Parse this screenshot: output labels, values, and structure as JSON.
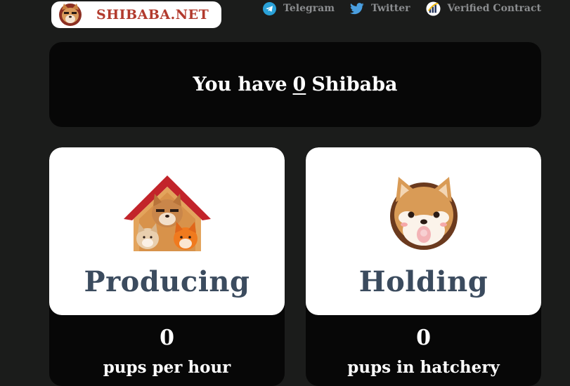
{
  "header": {
    "logo_text": "SHIBABA.NET",
    "links": [
      {
        "label": "Telegram",
        "icon": "telegram-icon"
      },
      {
        "label": "Twitter",
        "icon": "twitter-icon"
      },
      {
        "label": "Verified Contract",
        "icon": "chart-icon"
      }
    ]
  },
  "balance": {
    "prefix": "You have",
    "amount": "0",
    "suffix": "Shibaba"
  },
  "cards": [
    {
      "title": "Producing",
      "value": "0",
      "label": "pups per hour",
      "icon": "doghouse-icon"
    },
    {
      "title": "Holding",
      "value": "0",
      "label": "pups in hatchery",
      "icon": "shiba-face-icon"
    }
  ],
  "colors": {
    "background": "#1b1c1b",
    "card_dark": "#070707",
    "brand_red": "#b23a2d",
    "title_slate": "#3b4b5e",
    "link_gray": "#8b8d8f",
    "telegram_blue": "#2aa1d8",
    "twitter_blue": "#4a9fe0"
  }
}
